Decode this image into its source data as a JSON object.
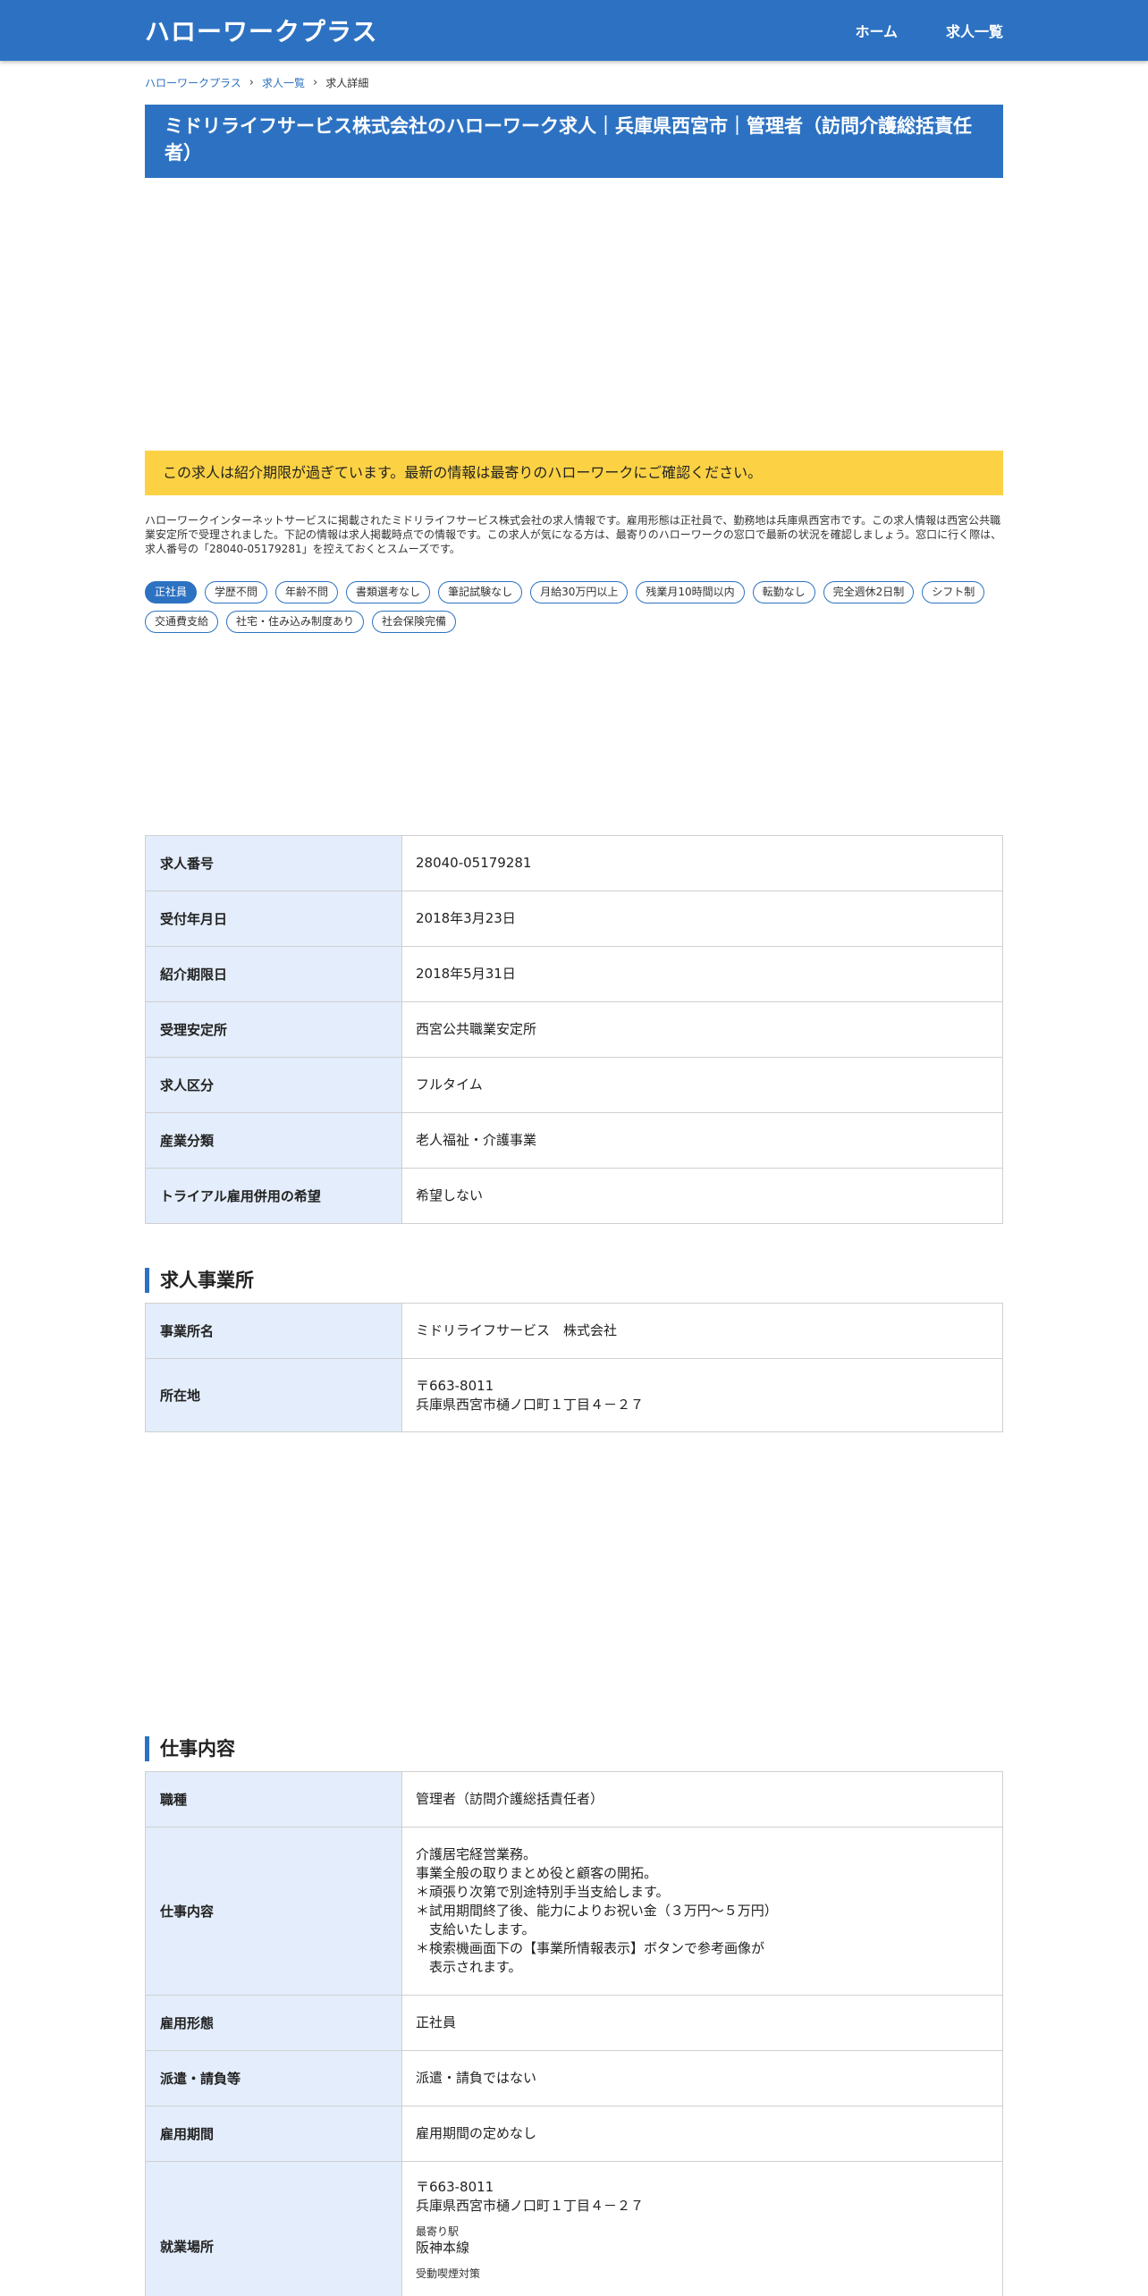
{
  "header": {
    "site_title": "ハローワークプラス",
    "nav": [
      "ホーム",
      "求人一覧"
    ]
  },
  "breadcrumb": [
    "ハローワークプラス",
    "求人一覧",
    "求人詳細"
  ],
  "page_title": "ミドリライフサービス株式会社のハローワーク求人｜兵庫県西宮市｜管理者（訪問介護総括責任者）",
  "notice": "この求人は紹介期限が過ぎています。最新の情報は最寄りのハローワークにご確認ください。",
  "description": "ハローワークインターネットサービスに掲載されたミドリライフサービス株式会社の求人情報です。雇用形態は正社員で、勤務地は兵庫県西宮市です。この求人情報は西宮公共職業安定所で受理されました。下記の情報は求人掲載時点での情報です。この求人が気になる方は、最寄りのハローワークの窓口で最新の状況を確認しましょう。窓口に行く際は、求人番号の「28040-05179281」を控えておくとスムーズです。",
  "tags": [
    "正社員",
    "学歴不問",
    "年齢不問",
    "書類選考なし",
    "筆記試験なし",
    "月給30万円以上",
    "残業月10時間以内",
    "転勤なし",
    "完全週休2日制",
    "シフト制",
    "交通費支給",
    "社宅・住み込み制度あり",
    "社会保険完備"
  ],
  "basic_info": [
    {
      "label": "求人番号",
      "value": "28040-05179281"
    },
    {
      "label": "受付年月日",
      "value": "2018年3月23日"
    },
    {
      "label": "紹介期限日",
      "value": "2018年5月31日"
    },
    {
      "label": "受理安定所",
      "value": "西宮公共職業安定所"
    },
    {
      "label": "求人区分",
      "value": "フルタイム"
    },
    {
      "label": "産業分類",
      "value": "老人福祉・介護事業"
    },
    {
      "label": "トライアル雇用併用の希望",
      "value": "希望しない"
    }
  ],
  "office": {
    "heading": "求人事業所",
    "rows": [
      {
        "label": "事業所名",
        "value": "ミドリライフサービス　株式会社"
      },
      {
        "label": "所在地",
        "value": "〒663-8011\n兵庫県西宮市樋ノ口町１丁目４－２７"
      }
    ]
  },
  "job": {
    "heading": "仕事内容",
    "rows": [
      {
        "label": "職種",
        "value": "管理者（訪問介護総括責任者）"
      },
      {
        "label": "仕事内容",
        "value": "介護居宅経営業務。\n事業全般の取りまとめ役と顧客の開拓。\n＊頑張り次第で別途特別手当支給します。\n＊試用期間終了後、能力によりお祝い金（３万円～５万円）\n　支給いたします。\n＊検索機画面下の【事業所情報表示】ボタンで参考画像が\n　表示されます。"
      },
      {
        "label": "雇用形態",
        "value": "正社員"
      },
      {
        "label": "派遣・請負等",
        "value": "派遣・請負ではない"
      },
      {
        "label": "雇用期間",
        "value": "雇用期間の定めなし"
      }
    ],
    "workplace": {
      "label": "就業場所",
      "address": "〒663-8011\n兵庫県西宮市樋ノ口町１丁目４－２７",
      "station_label": "最寄り駅",
      "station": "阪神本線",
      "smoking_label": "受動喫煙対策"
    }
  }
}
